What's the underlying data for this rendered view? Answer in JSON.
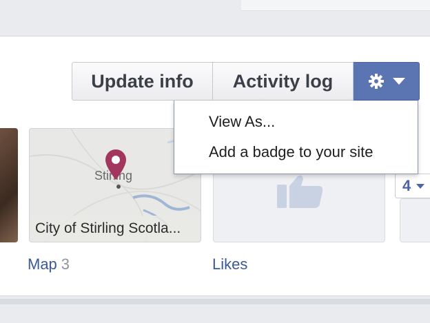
{
  "toolbar": {
    "update_info_label": "Update info",
    "activity_log_label": "Activity log",
    "gear_icon": "gear-icon",
    "caret_icon": "caret-down-icon"
  },
  "gear_menu": {
    "items": [
      {
        "label": "View As..."
      },
      {
        "label": "Add a badge to your site"
      }
    ]
  },
  "tiles": {
    "map": {
      "town_label": "Stirling",
      "caption": "City of Stirling Scotla...",
      "pin_icon": "map-pin-icon",
      "pin_color": "#a3365f"
    },
    "likes": {
      "icon": "thumbs-up-icon"
    },
    "badge": {
      "count": "4"
    }
  },
  "labels": {
    "map": "Map",
    "map_count": "3",
    "likes": "Likes"
  },
  "colors": {
    "accent": "#5b75b3",
    "link": "#3b5998",
    "background": "#e9ebee"
  }
}
